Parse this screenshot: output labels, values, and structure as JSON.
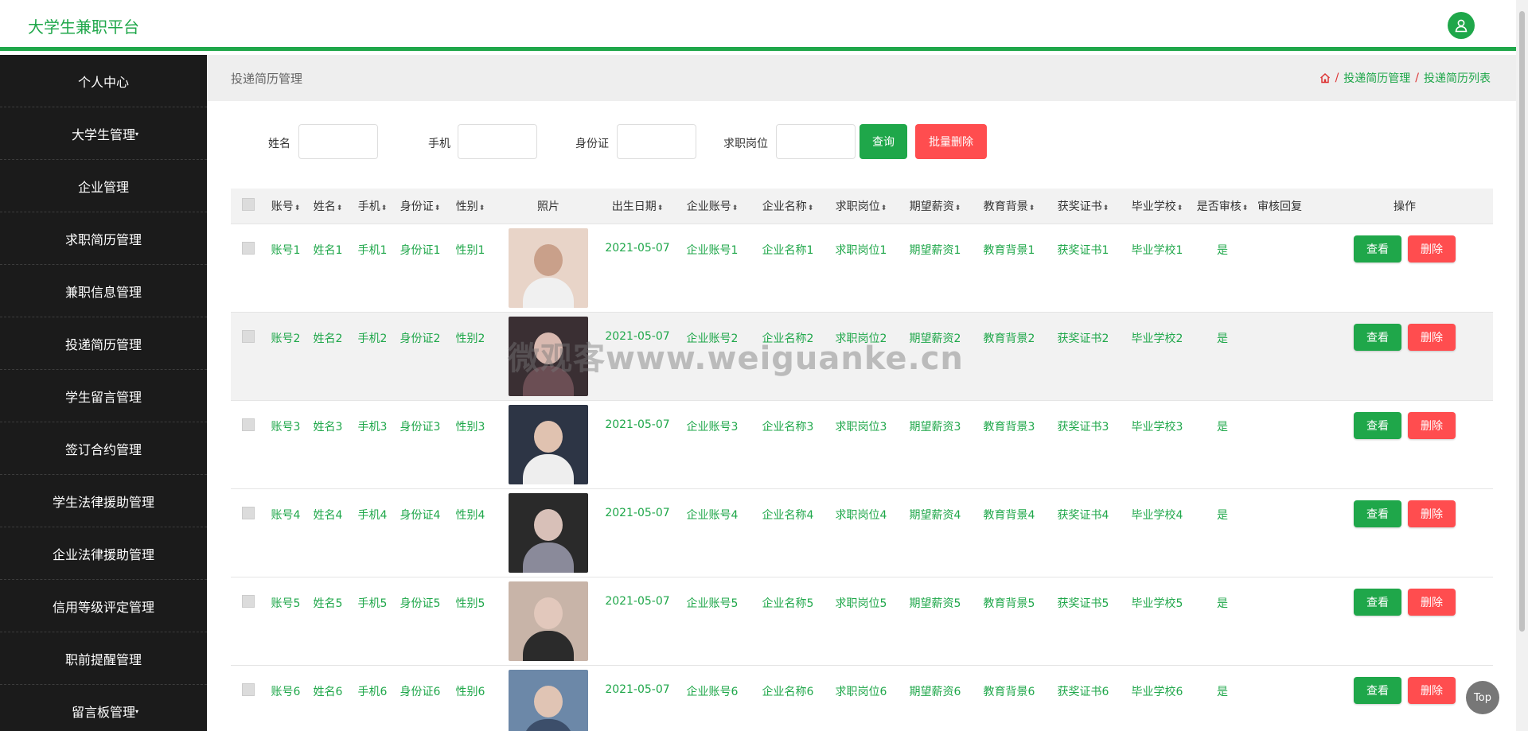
{
  "app": {
    "title": "大学生兼职平台"
  },
  "sidebar": {
    "items": [
      {
        "label": "个人中心",
        "caret": false
      },
      {
        "label": "大学生管理",
        "caret": true
      },
      {
        "label": "企业管理",
        "caret": false
      },
      {
        "label": "求职简历管理",
        "caret": false
      },
      {
        "label": "兼职信息管理",
        "caret": false
      },
      {
        "label": "投递简历管理",
        "caret": false
      },
      {
        "label": "学生留言管理",
        "caret": false
      },
      {
        "label": "签订合约管理",
        "caret": false
      },
      {
        "label": "学生法律援助管理",
        "caret": false
      },
      {
        "label": "企业法律援助管理",
        "caret": false
      },
      {
        "label": "信用等级评定管理",
        "caret": false
      },
      {
        "label": "职前提醒管理",
        "caret": false
      },
      {
        "label": "留言板管理",
        "caret": true
      }
    ]
  },
  "page": {
    "title": "投递简历管理",
    "breadcrumb": [
      "投递简历管理",
      "投递简历列表"
    ]
  },
  "search": {
    "fields": [
      {
        "label": "姓名",
        "value": ""
      },
      {
        "label": "手机",
        "value": ""
      },
      {
        "label": "身份证",
        "value": ""
      },
      {
        "label": "求职岗位",
        "value": ""
      }
    ],
    "query_label": "查询",
    "batch_delete_label": "批量删除"
  },
  "table": {
    "headers": [
      "账号",
      "姓名",
      "手机",
      "身份证",
      "性别",
      "照片",
      "出生日期",
      "企业账号",
      "企业名称",
      "求职岗位",
      "期望薪资",
      "教育背景",
      "获奖证书",
      "毕业学校",
      "是否审核",
      "审核回复",
      "操作"
    ],
    "view_label": "查看",
    "delete_label": "删除",
    "rows": [
      {
        "account": "账号1",
        "name": "姓名1",
        "phone": "手机1",
        "idcard": "身份证1",
        "gender": "性别1",
        "birth": "2021-05-07",
        "company_account": "企业账号1",
        "company_name": "企业名称1",
        "position": "求职岗位1",
        "salary": "期望薪资1",
        "education": "教育背景1",
        "certificate": "获奖证书1",
        "school": "毕业学校1",
        "reviewed": "是",
        "reply": ""
      },
      {
        "account": "账号2",
        "name": "姓名2",
        "phone": "手机2",
        "idcard": "身份证2",
        "gender": "性别2",
        "birth": "2021-05-07",
        "company_account": "企业账号2",
        "company_name": "企业名称2",
        "position": "求职岗位2",
        "salary": "期望薪资2",
        "education": "教育背景2",
        "certificate": "获奖证书2",
        "school": "毕业学校2",
        "reviewed": "是",
        "reply": ""
      },
      {
        "account": "账号3",
        "name": "姓名3",
        "phone": "手机3",
        "idcard": "身份证3",
        "gender": "性别3",
        "birth": "2021-05-07",
        "company_account": "企业账号3",
        "company_name": "企业名称3",
        "position": "求职岗位3",
        "salary": "期望薪资3",
        "education": "教育背景3",
        "certificate": "获奖证书3",
        "school": "毕业学校3",
        "reviewed": "是",
        "reply": ""
      },
      {
        "account": "账号4",
        "name": "姓名4",
        "phone": "手机4",
        "idcard": "身份证4",
        "gender": "性别4",
        "birth": "2021-05-07",
        "company_account": "企业账号4",
        "company_name": "企业名称4",
        "position": "求职岗位4",
        "salary": "期望薪资4",
        "education": "教育背景4",
        "certificate": "获奖证书4",
        "school": "毕业学校4",
        "reviewed": "是",
        "reply": ""
      },
      {
        "account": "账号5",
        "name": "姓名5",
        "phone": "手机5",
        "idcard": "身份证5",
        "gender": "性别5",
        "birth": "2021-05-07",
        "company_account": "企业账号5",
        "company_name": "企业名称5",
        "position": "求职岗位5",
        "salary": "期望薪资5",
        "education": "教育背景5",
        "certificate": "获奖证书5",
        "school": "毕业学校5",
        "reviewed": "是",
        "reply": ""
      },
      {
        "account": "账号6",
        "name": "姓名6",
        "phone": "手机6",
        "idcard": "身份证6",
        "gender": "性别6",
        "birth": "2021-05-07",
        "company_account": "企业账号6",
        "company_name": "企业名称6",
        "position": "求职岗位6",
        "salary": "期望薪资6",
        "education": "教育背景6",
        "certificate": "获奖证书6",
        "school": "毕业学校6",
        "reviewed": "是",
        "reply": ""
      }
    ]
  },
  "watermark": "微观客www.weiguanke.cn",
  "top_button_label": "Top",
  "colors": {
    "primary": "#1fa74a",
    "danger": "#ff4d4f",
    "sidebar": "#1b1b1b"
  },
  "icons": {
    "user": "user-icon",
    "home": "home-icon",
    "sort": "sort-icon"
  }
}
